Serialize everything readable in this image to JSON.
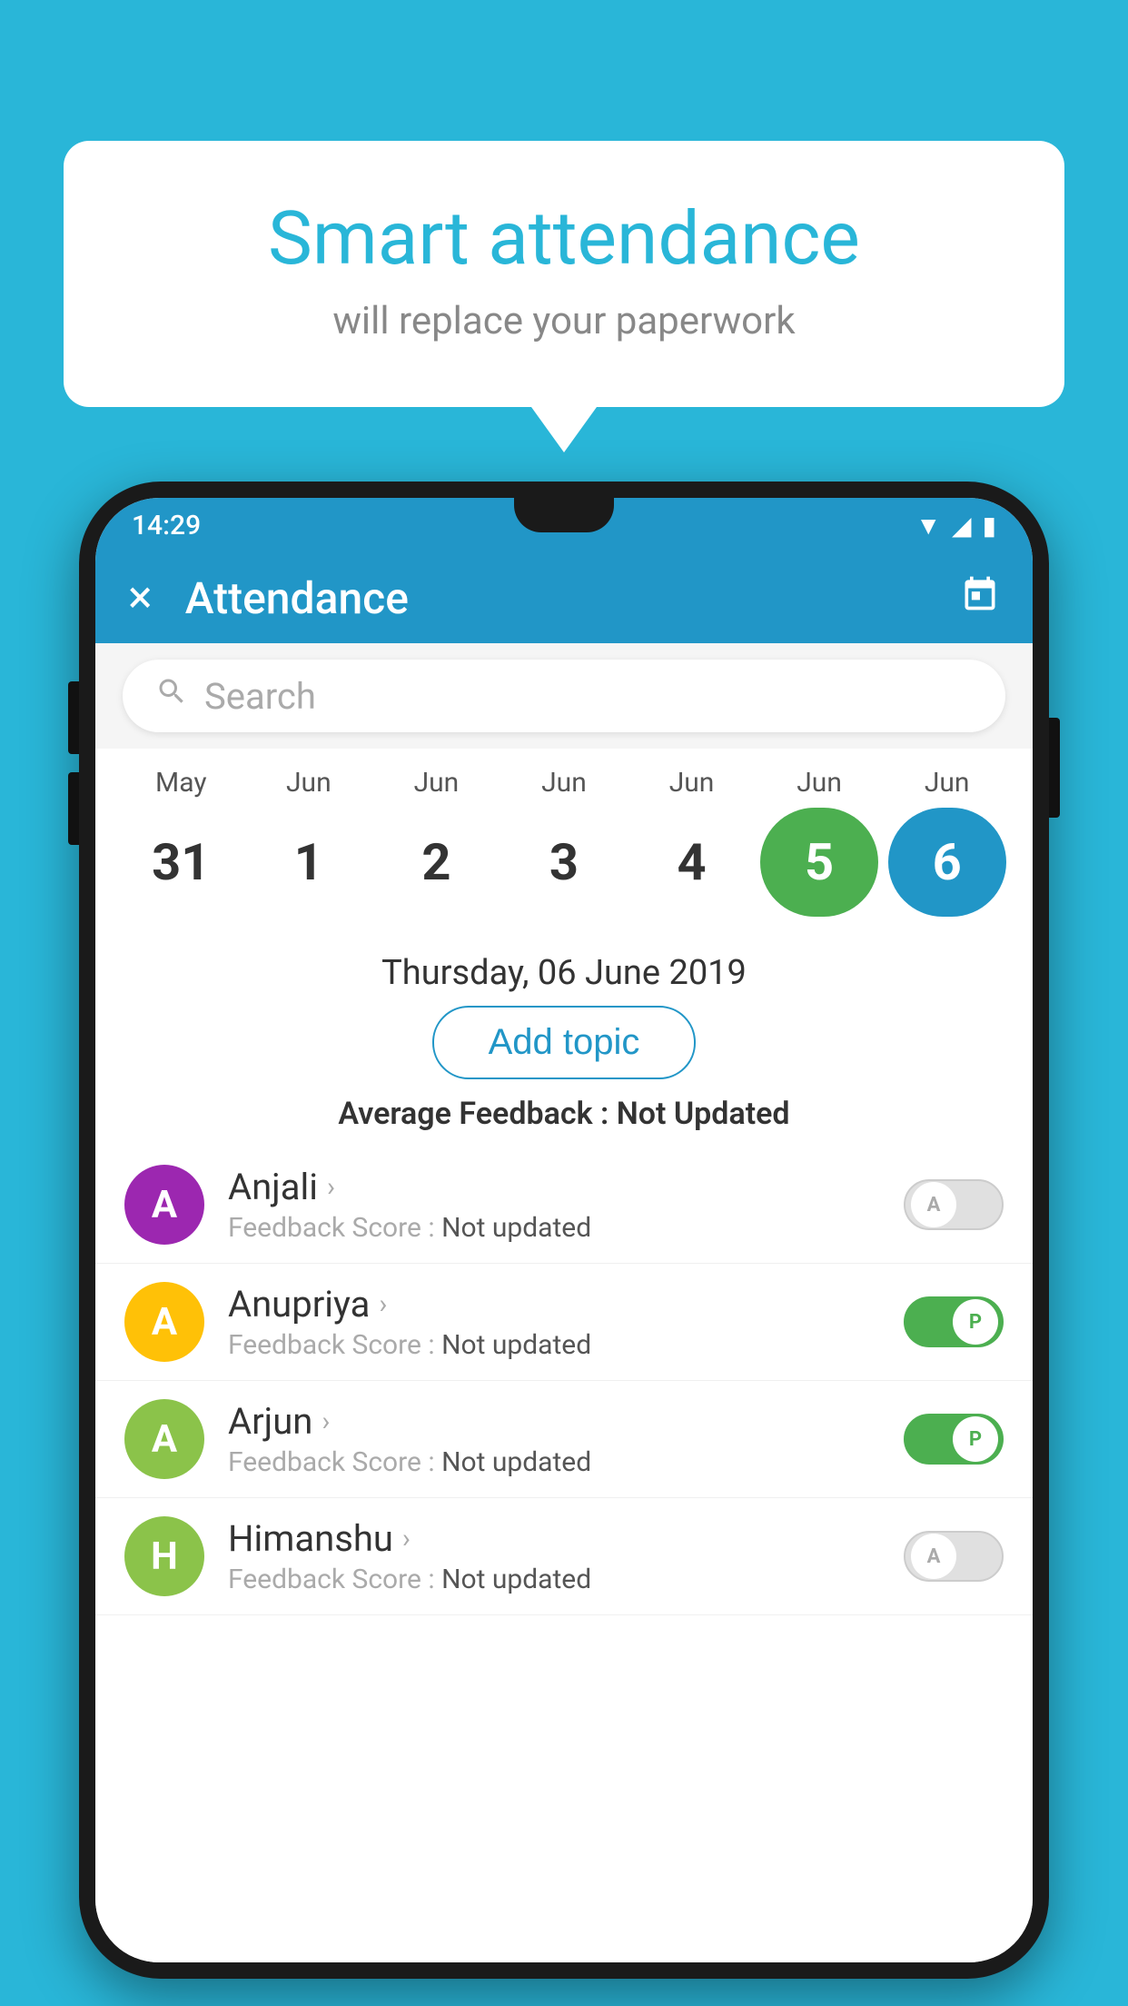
{
  "background": {
    "color": "#29b6d8"
  },
  "speech_bubble": {
    "title": "Smart attendance",
    "subtitle": "will replace your paperwork"
  },
  "phone": {
    "status_bar": {
      "time": "14:29"
    },
    "app_bar": {
      "title": "Attendance",
      "close_label": "×",
      "calendar_icon": "📅"
    },
    "search": {
      "placeholder": "Search"
    },
    "calendar": {
      "months": [
        "May",
        "Jun",
        "Jun",
        "Jun",
        "Jun",
        "Jun",
        "Jun"
      ],
      "days": [
        "31",
        "1",
        "2",
        "3",
        "4",
        "5",
        "6"
      ],
      "states": [
        "normal",
        "normal",
        "normal",
        "normal",
        "normal",
        "today",
        "selected"
      ]
    },
    "selected_date_label": "Thursday, 06 June 2019",
    "add_topic_label": "Add topic",
    "avg_feedback_label": "Average Feedback :",
    "avg_feedback_value": "Not Updated",
    "students": [
      {
        "name": "Anjali",
        "avatar_letter": "A",
        "avatar_color": "#9c27b0",
        "feedback_label": "Feedback Score :",
        "feedback_value": "Not updated",
        "toggle_state": "off",
        "toggle_letter": "A"
      },
      {
        "name": "Anupriya",
        "avatar_letter": "A",
        "avatar_color": "#ffc107",
        "feedback_label": "Feedback Score :",
        "feedback_value": "Not updated",
        "toggle_state": "on",
        "toggle_letter": "P"
      },
      {
        "name": "Arjun",
        "avatar_letter": "A",
        "avatar_color": "#8bc34a",
        "feedback_label": "Feedback Score :",
        "feedback_value": "Not updated",
        "toggle_state": "on",
        "toggle_letter": "P"
      },
      {
        "name": "Himanshu",
        "avatar_letter": "H",
        "avatar_color": "#8bc34a",
        "feedback_label": "Feedback Score :",
        "feedback_value": "Not updated",
        "toggle_state": "off",
        "toggle_letter": "A"
      }
    ]
  }
}
